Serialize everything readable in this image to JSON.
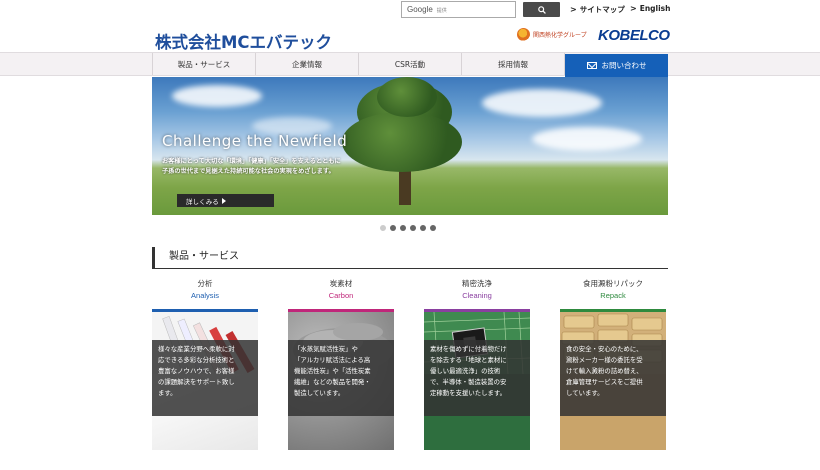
{
  "util": {
    "search_brand": "Google",
    "search_tag": "提供",
    "sitemap": "サイトマップ",
    "english": "English"
  },
  "header": {
    "logo": "株式会社MCエバテック",
    "group": "関西熱化学グループ",
    "kobelco": "KOBELCO"
  },
  "nav": {
    "items": [
      "製品・サービス",
      "企業情報",
      "CSR活動",
      "採用情報"
    ],
    "contact": "お問い合わせ"
  },
  "hero": {
    "title": "Challenge the Newfield",
    "line1": "お客様にとって大切な「環境」「健康」「安全」を支えるとともに",
    "line2": "子孫の世代まで見据えた持続可能な社会の実現をめざします。",
    "more": "詳しくみる",
    "slides": 6,
    "active": 1
  },
  "section": {
    "title": "製品・サービス"
  },
  "products": [
    {
      "ja": "分析",
      "en": "Analysis",
      "color": "#1e5fb0",
      "lines": [
        "様々な産業分野へ柔軟に対",
        "応できる多彩な分析技術と",
        "豊富なノウハウで、お客様",
        "の課題解決をサポート致し",
        "ます。"
      ]
    },
    {
      "ja": "炭素材",
      "en": "Carbon",
      "color": "#c0267a",
      "lines": [
        "「水蒸気賦活性炭」や",
        "「アルカリ賦活法による高",
        "機能活性炭」や「活性炭素",
        "繊維」などの製品を開発・",
        "製造しています。"
      ]
    },
    {
      "ja": "精密洗浄",
      "en": "Cleaning",
      "color": "#8a3fa0",
      "lines": [
        "素材を傷めずに付着物だけ",
        "を除去する「地球と素材に",
        "優しい最適洗浄」の技術",
        "で、半導体・製造装置の安",
        "定稼動を支援いたします。"
      ]
    },
    {
      "ja": "食用澱粉リパック",
      "en": "Repack",
      "color": "#2e8a3e",
      "lines": [
        "食の安全・安心のために、",
        "澱粉メーカー様の委託を受",
        "けて輸入澱粉の詰め替え、",
        "倉庫管理サービスをご提供",
        "しています。"
      ]
    }
  ]
}
